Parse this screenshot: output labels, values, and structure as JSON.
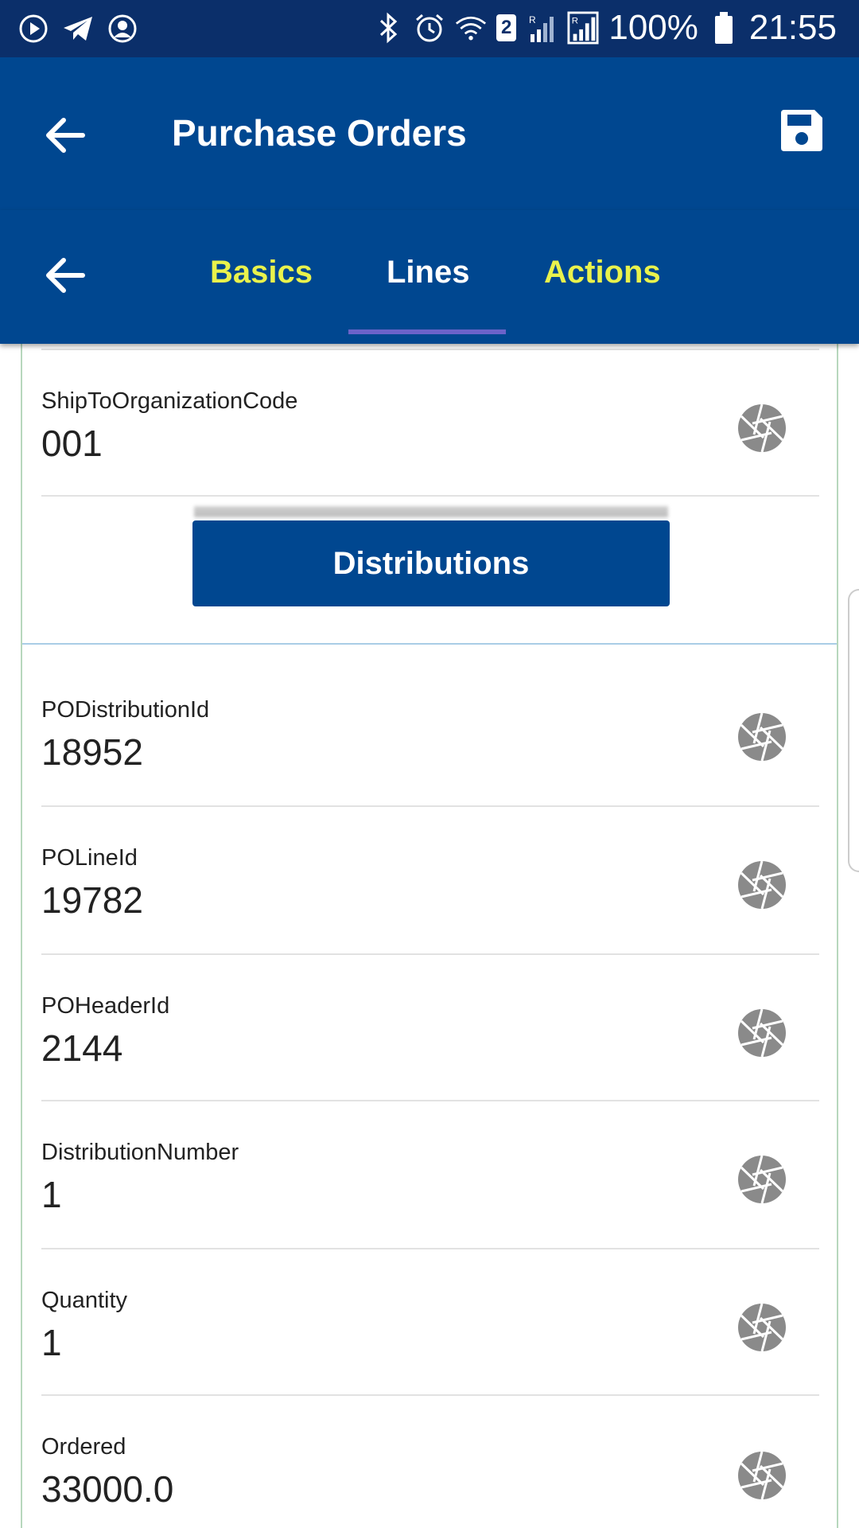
{
  "status_bar": {
    "left_icons": [
      "play-circle-icon",
      "telegram-icon",
      "account-circle-icon"
    ],
    "right_icons": [
      "bluetooth-icon",
      "alarm-icon",
      "wifi-icon",
      "signal-icon",
      "signal-roaming-icon",
      "battery-icon"
    ],
    "sim_badge": "2",
    "battery": "100%",
    "time": "21:55"
  },
  "app_bar": {
    "title": "Purchase Orders",
    "back_icon": "arrow-back-icon",
    "save_icon": "save-icon"
  },
  "tabs": {
    "items": [
      {
        "label": "Basics",
        "active": false
      },
      {
        "label": "Lines",
        "active": true
      },
      {
        "label": "Actions",
        "active": false
      }
    ],
    "active_color": "#ffffff",
    "inactive_color": "#e9f24c",
    "indicator_color": "#6b63c9"
  },
  "line_fields": [
    {
      "label": "ShipToOrganizationCode",
      "value": "001"
    }
  ],
  "distributions_button": {
    "label": "Distributions"
  },
  "distribution_fields": [
    {
      "label": "PODistributionId",
      "value": "18952"
    },
    {
      "label": "POLineId",
      "value": "19782"
    },
    {
      "label": "POHeaderId",
      "value": "2144"
    },
    {
      "label": "DistributionNumber",
      "value": "1"
    },
    {
      "label": "Quantity",
      "value": "1"
    },
    {
      "label": "Ordered",
      "value": "33000.0"
    }
  ],
  "field_action_icon": "camera-aperture-icon",
  "colors": {
    "status_bar": "#0b2f6a",
    "primary": "#004790",
    "icon_gray": "#8a8a8a"
  }
}
